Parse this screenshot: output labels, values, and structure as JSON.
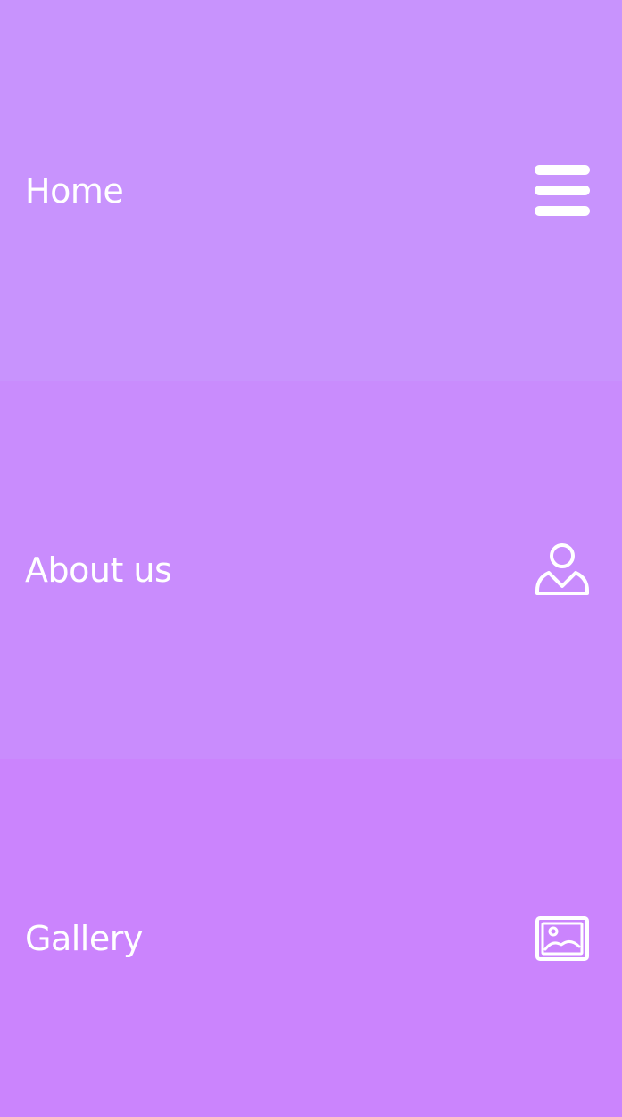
{
  "menu": {
    "items": [
      {
        "label": "Home",
        "icon": "hamburger-menu-icon",
        "color": "#c893fd"
      },
      {
        "label": "About us",
        "icon": "user-icon",
        "color": "#c98cfd"
      },
      {
        "label": "Gallery",
        "icon": "image-icon",
        "color": "#cb84fd"
      }
    ]
  }
}
